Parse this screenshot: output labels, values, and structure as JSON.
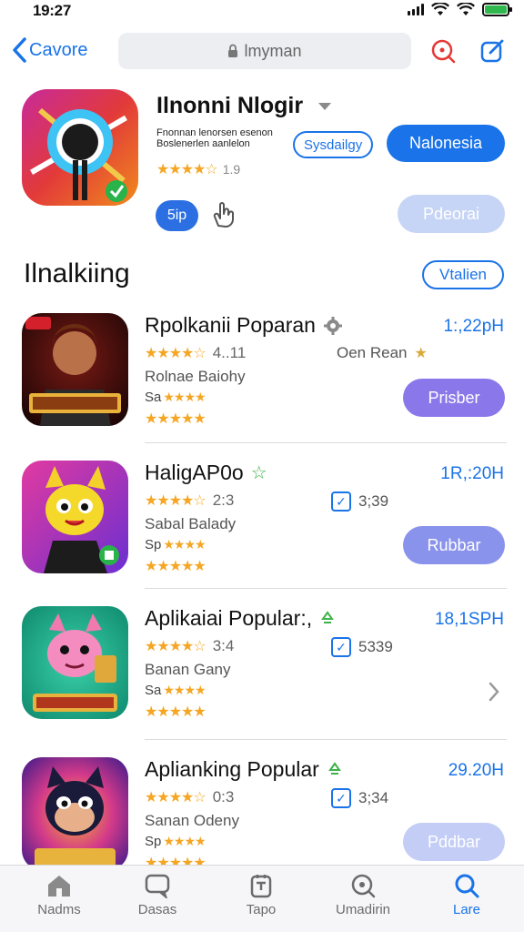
{
  "status": {
    "time": "19:27"
  },
  "nav": {
    "back_label": "Cavore",
    "search_text": "lmyman"
  },
  "app": {
    "title": "Ilnonni Nlogir",
    "subtitle": "Fnonnan lenorsen esenon Boslenerlen aanlelon",
    "rating_stars": "★★★★☆",
    "rating_value": "1.9",
    "chip_label": "Sysdailgy",
    "primary_button": "Nalonesia",
    "small_pill": "5ip",
    "secondary_button": "Pdeorai"
  },
  "section": {
    "title": "Ilnalkiing",
    "link": "Vtalien"
  },
  "items": [
    {
      "name": "Rpolkanii Poparan",
      "badge": "gear",
      "time": "1:,22pH",
      "stars": "★★★★☆",
      "rating": "4..11",
      "meta": "Oen Rean",
      "meta_icon": "star",
      "subtitle": "Rolnae Baiohy",
      "mini_prefix": "Sa",
      "mini_stars": "★★★★",
      "stars_row": "★★★★★",
      "action": "Prisber",
      "action_color": "#8a78ea",
      "has_chevron": false
    },
    {
      "name": "HaligAP0o",
      "badge": "star",
      "time": "1R,:20H",
      "stars": "★★★★☆",
      "rating": "2:3",
      "meta": "3;39",
      "meta_icon": "check",
      "subtitle": "Sabal Balady",
      "mini_prefix": "Sp",
      "mini_stars": "★★★★",
      "stars_row": "★★★★★",
      "action": "Rubbar",
      "action_color": "#8a93ec",
      "has_chevron": false
    },
    {
      "name": "Aplikaiai Popular:,",
      "badge": "recycle",
      "time": "18,1SPH",
      "stars": "★★★★☆",
      "rating": "3:4",
      "meta": "5339",
      "meta_icon": "check",
      "subtitle": "Banan Gany",
      "mini_prefix": "Sa",
      "mini_stars": "★★★★",
      "stars_row": "★★★★★",
      "action": "",
      "action_color": "",
      "has_chevron": true
    },
    {
      "name": "Aplianking Popular",
      "badge": "recycle",
      "time": "29.20H",
      "stars": "★★★★☆",
      "rating": "0:3",
      "meta": "3;34",
      "meta_icon": "check",
      "subtitle": "Sanan Odeny",
      "mini_prefix": "Sp",
      "mini_stars": "★★★★",
      "stars_row": "★★★★★",
      "action": "Pddbar",
      "action_color": "#c3cdf6",
      "has_chevron": false
    }
  ],
  "tabs": [
    {
      "label": "Nadms",
      "icon": "home-icon",
      "active": false
    },
    {
      "label": "Dasas",
      "icon": "chat-icon",
      "active": false
    },
    {
      "label": "Tapo",
      "icon": "apps-icon",
      "active": false
    },
    {
      "label": "Umadirin",
      "icon": "search-icon",
      "active": false
    },
    {
      "label": "Lare",
      "icon": "search-icon",
      "active": true
    }
  ],
  "colors": {
    "accent": "#1a73e8",
    "star": "#f5a623"
  }
}
